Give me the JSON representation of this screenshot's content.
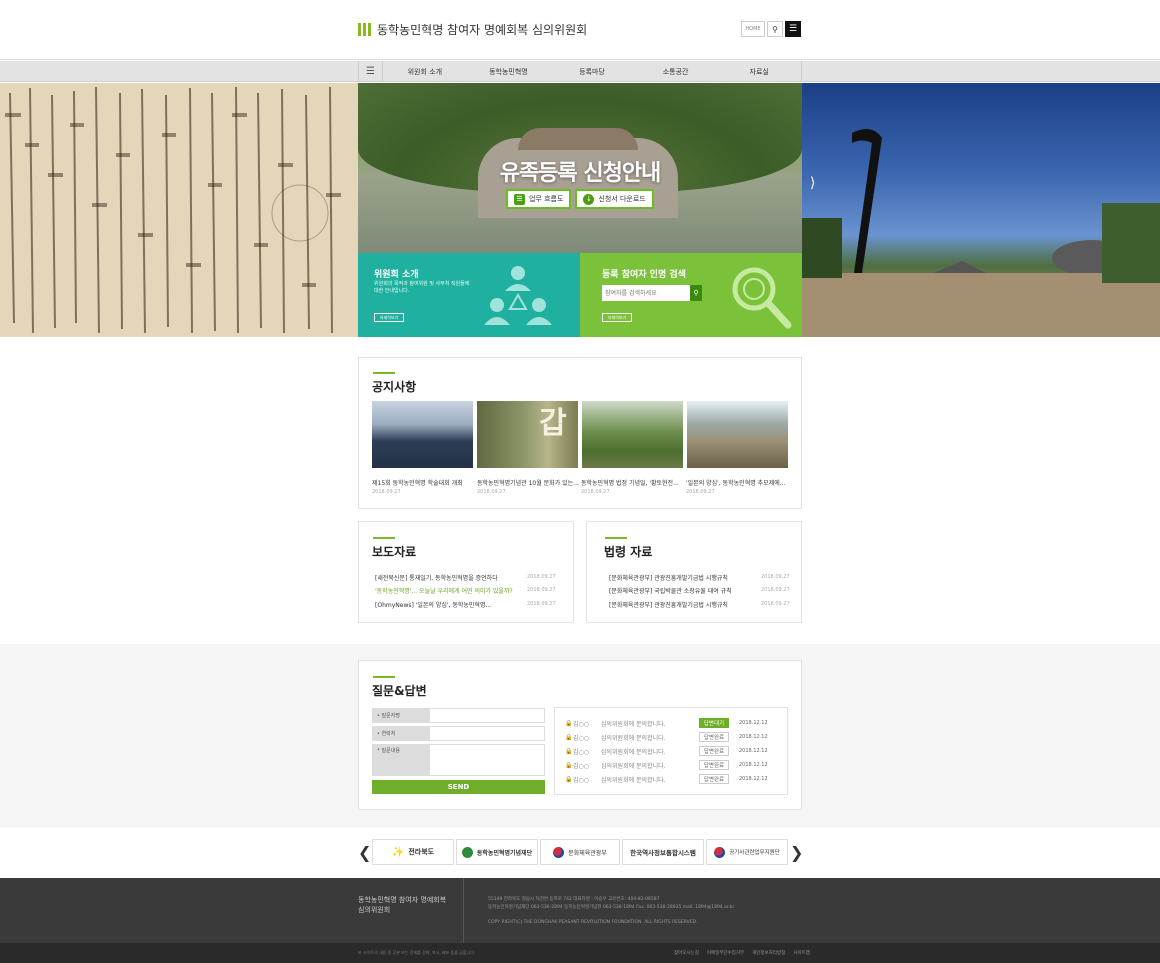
{
  "header": {
    "logo_text": "동학농민혁명 참여자 명예회복 심의위원회",
    "home_label": "HOME",
    "search_icon": "search-icon",
    "menu_icon": "menu-icon"
  },
  "nav": {
    "items": [
      "위원회 소개",
      "동학농민혁명",
      "등록마당",
      "소통공간",
      "자료실"
    ]
  },
  "hero": {
    "title": "유족등록 신청안내",
    "btn_flow": "업무 흐름도",
    "btn_download": "신청서 다운로드",
    "committee_title": "위원회 소개",
    "committee_desc": "위원회의 목적과 참여위원 및 사무처 직원들에 대한 안내입니다.",
    "committee_more": "자세히보기",
    "search_title": "등록 참여자 인명 검색",
    "search_placeholder": "참여자를 검색하세요",
    "search_more": "자세히보기"
  },
  "notice": {
    "title": "공지사항",
    "items": [
      {
        "caption": "제15회 동학농민혁명 학술대회 개최",
        "date": "2018.09.27"
      },
      {
        "caption": "동학농민혁명기념관 10월 문화가 있는...",
        "date": "2018.09.27"
      },
      {
        "caption": "동학농민혁명 법정 기념일, '황토현전...",
        "date": "2018.09.27"
      },
      {
        "caption": "'일본의 양심', 동학농민혁명 추모제에...",
        "date": "2018.09.27"
      }
    ]
  },
  "press": {
    "title": "보도자료",
    "items": [
      {
        "text": "[새전북신문] 통재일기, 동학농민혁명을 증언하다",
        "date": "2018.09.27"
      },
      {
        "text": "'동학농민혁명'... 오늘날 우리에게 어떤 의미가 있을까?",
        "date": "2018.09.27"
      },
      {
        "text": "[OhmyNews] '일본의 양심', 동학농민혁명...",
        "date": "2018.09.27"
      }
    ]
  },
  "law": {
    "title": "법령 자료",
    "items": [
      {
        "text": "[문화체육관광부] 관광진흥개발기금법 시행규칙",
        "date": "2018.09.27"
      },
      {
        "text": "[문화체육관광부] 국립박물관 소장유물 대여 규칙",
        "date": "2018.09.27"
      },
      {
        "text": "[문화체육관광부] 관광진흥개발기금법 시행규칙",
        "date": "2018.09.27"
      }
    ]
  },
  "qa": {
    "title": "질문&답변",
    "form": {
      "subject_label": "질문자명",
      "contact_label": "연락처",
      "content_label": "질문내용",
      "send_label": "SEND"
    },
    "rows": [
      {
        "name": "김○○",
        "subject": "심의위원회에 문의합니다.",
        "status": "답변대기",
        "date": "2018.12.12"
      },
      {
        "name": "김○○",
        "subject": "심의위원회에 문의합니다.",
        "status": "답변완료",
        "date": "2018.12.12"
      },
      {
        "name": "김○○",
        "subject": "심의위원회에 문의합니다.",
        "status": "답변완료",
        "date": "2018.12.12"
      },
      {
        "name": "김○○",
        "subject": "심의위원회에 문의합니다.",
        "status": "답변완료",
        "date": "2018.12.12"
      },
      {
        "name": "김○○",
        "subject": "심의위원회에 문의합니다.",
        "status": "답변완료",
        "date": "2018.12.12"
      }
    ]
  },
  "partners": {
    "items": [
      "전라북도",
      "동학농민혁명기념재단",
      "문화체육관광부",
      "한국역사정보통합시스템",
      "공기사관련업무지원단"
    ]
  },
  "footer": {
    "logo": "동학농민혁명 참여자 명예회복 심의위원회",
    "address": "55149 전라북도 정읍시 덕천면 동학로 742 대표자명 : 이승우 고유번호: 404-82-08587",
    "address2": "동학농민혁명기념재단 063-536-2894 동학농민혁명기념관 063-536-1894 Fax. 063-538-28935 mail. 1894@1894.or.kr",
    "copyright": "COPY RIGHT(C) THE DONGHAK PEASANT REVOLUTION FOUNDATION. ALL RIGHTS RESERVED.",
    "bottom_note": "본 사이트의 내용 중 무분 또는 전체를 전재, 복사, 배포 등을 금합니다.",
    "links": [
      "찾아오시는길",
      "이메일무단수집거부",
      "개인정보처리방침",
      "사이트맵"
    ]
  },
  "colors": {
    "accent_green": "#7bb82a",
    "teal": "#1fb0a0",
    "lime": "#7bc23a"
  }
}
